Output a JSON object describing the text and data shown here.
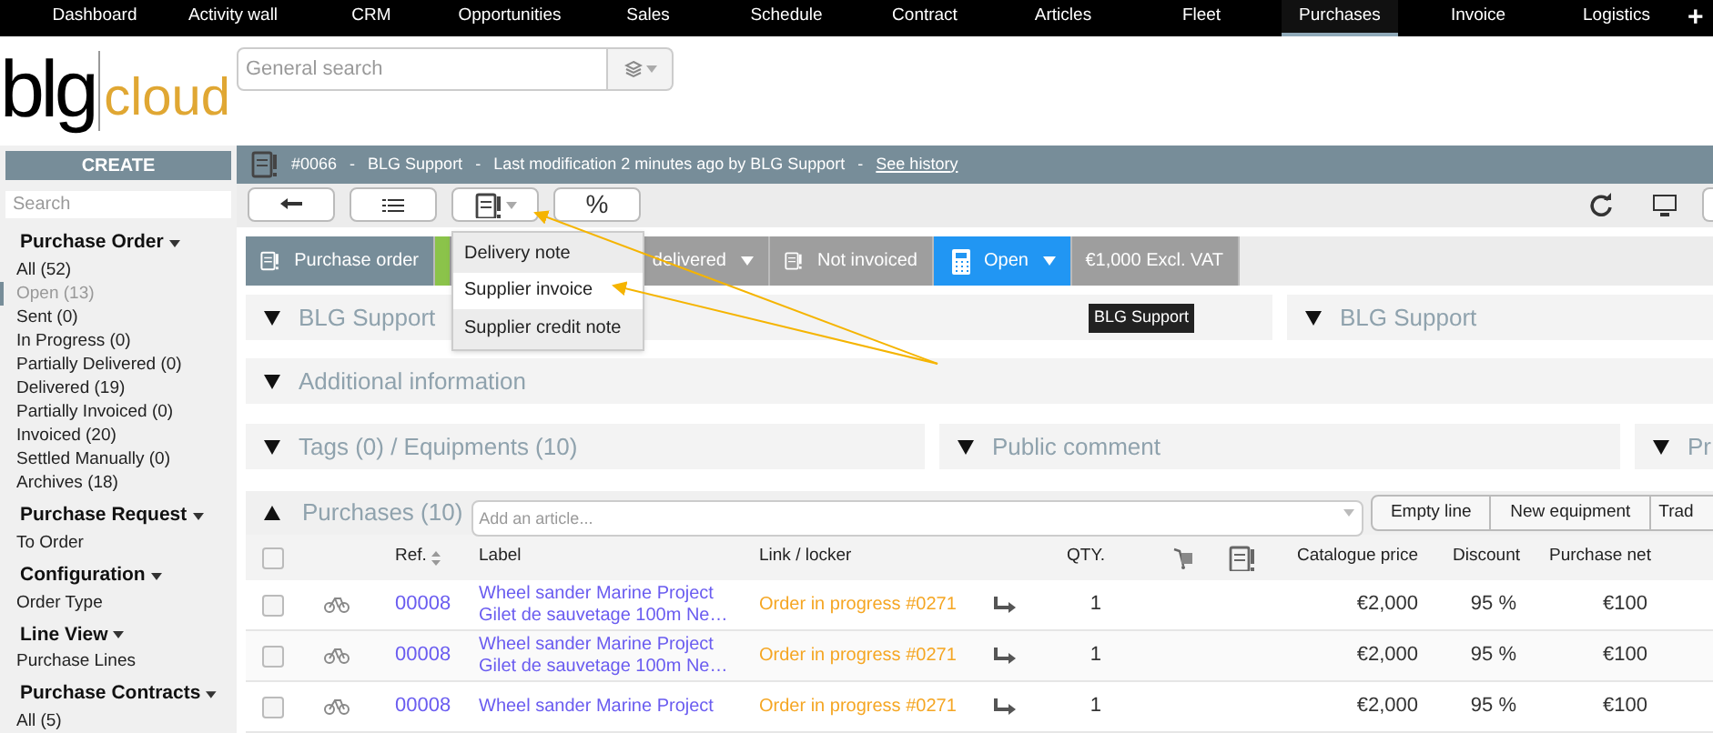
{
  "nav": {
    "items": [
      {
        "label": "Dashboard",
        "selected": false
      },
      {
        "label": "Activity wall",
        "selected": false
      },
      {
        "label": "CRM",
        "selected": false
      },
      {
        "label": "Opportunities",
        "selected": false
      },
      {
        "label": "Sales",
        "selected": false
      },
      {
        "label": "Schedule",
        "selected": false
      },
      {
        "label": "Contract",
        "selected": false
      },
      {
        "label": "Articles",
        "selected": false
      },
      {
        "label": "Fleet",
        "selected": false
      },
      {
        "label": "Purchases",
        "selected": true
      },
      {
        "label": "Invoice",
        "selected": false
      },
      {
        "label": "Logistics",
        "selected": false
      }
    ],
    "add": "+"
  },
  "logo": {
    "first": "blg",
    "second": "cloud"
  },
  "search": {
    "placeholder": "General search"
  },
  "sidebar": {
    "create": "CREATE",
    "search_placeholder": "Search",
    "sections": [
      {
        "title": "Purchase Order",
        "items": [
          {
            "label": "All (52)",
            "selected": false
          },
          {
            "label": "Open (13)",
            "selected": true
          },
          {
            "label": "Sent (0)",
            "selected": false
          },
          {
            "label": "In Progress (0)",
            "selected": false
          },
          {
            "label": "Partially Delivered (0)",
            "selected": false
          },
          {
            "label": "Delivered (19)",
            "selected": false
          },
          {
            "label": "Partially Invoiced (0)",
            "selected": false
          },
          {
            "label": "Invoiced (20)",
            "selected": false
          },
          {
            "label": "Settled Manually (0)",
            "selected": false
          },
          {
            "label": "Archives (18)",
            "selected": false
          }
        ]
      },
      {
        "title": "Purchase Request",
        "items": [
          {
            "label": "To Order",
            "selected": false
          }
        ]
      },
      {
        "title": "Configuration",
        "items": [
          {
            "label": "Order Type",
            "selected": false
          }
        ]
      },
      {
        "title": "Line View",
        "items": [
          {
            "label": "Purchase Lines",
            "selected": false
          }
        ]
      },
      {
        "title": "Purchase Contracts",
        "items": [
          {
            "label": "All (5)",
            "selected": false
          }
        ]
      }
    ]
  },
  "header": {
    "number": "#0066",
    "sep1": "-",
    "author": "BLG Support",
    "sep2": "-",
    "modification": "Last modification 2 minutes ago by BLG Support",
    "sep3": "-",
    "history_link": "See history"
  },
  "toolbar": {
    "percent": "%",
    "menu": [
      {
        "label": "Delivery note",
        "selected": false
      },
      {
        "label": "Supplier invoice",
        "selected": true
      },
      {
        "label": "Supplier credit note",
        "selected": false
      }
    ]
  },
  "status_bar": [
    {
      "kind": "document",
      "label": "Purchase order",
      "dropdown": false,
      "color": "#778d99"
    },
    {
      "kind": "none",
      "dropdown": false,
      "color": "#8bc34a"
    },
    {
      "kind": "none",
      "label": "delivered",
      "dropdown": true,
      "color": "#9e9e9e"
    },
    {
      "kind": "invoice",
      "label": "Not invoiced",
      "dropdown": false,
      "color": "#9e9e9e"
    },
    {
      "kind": "calculator",
      "label": "Open",
      "dropdown": true,
      "color": "#2196f3"
    },
    {
      "kind": "none",
      "label": "€1,000 Excl. VAT",
      "dropdown": false,
      "color": "#9e9e9e"
    }
  ],
  "panels": [
    {
      "title": "BLG Support",
      "expanded": false,
      "tooltip": "BLG Support"
    },
    {
      "title": "BLG Support",
      "expanded": false
    },
    {
      "title": "Additional information",
      "expanded": false
    },
    {
      "title": "Tags (0) / Equipments (10)",
      "expanded": false
    },
    {
      "title": "Public comment",
      "expanded": false
    },
    {
      "title": "Pr",
      "expanded": false
    }
  ],
  "purchases": {
    "title": "Purchases (10)",
    "expanded": true,
    "placeholder": "Add an article...",
    "buttons": [
      "Empty line",
      "New equipment",
      "Trad"
    ]
  },
  "table": {
    "select_all": false,
    "columns": [
      "Ref.",
      "Label",
      "Link / locker",
      "QTY.",
      "Catalogue price",
      "Discount",
      "Purchase net"
    ],
    "rows": [
      {
        "selected": false,
        "ref": "00008",
        "label": [
          "Wheel sander Marine Project",
          "Gilet de sauvetage 100m Ne…"
        ],
        "link": "Order in progress #0271",
        "qty": "1",
        "catalogue_price": "€2,000",
        "discount": "95 %",
        "purchase_net": "€100"
      },
      {
        "selected": false,
        "ref": "00008",
        "label": [
          "Wheel sander Marine Project",
          "Gilet de sauvetage 100m Ne…"
        ],
        "link": "Order in progress #0271",
        "qty": "1",
        "catalogue_price": "€2,000",
        "discount": "95 %",
        "purchase_net": "€100"
      },
      {
        "selected": false,
        "ref": "00008",
        "label": [
          "Wheel sander Marine Project"
        ],
        "link": "Order in progress #0271",
        "qty": "1",
        "catalogue_price": "€2,000",
        "discount": "95 %",
        "purchase_net": "€100"
      }
    ]
  }
}
